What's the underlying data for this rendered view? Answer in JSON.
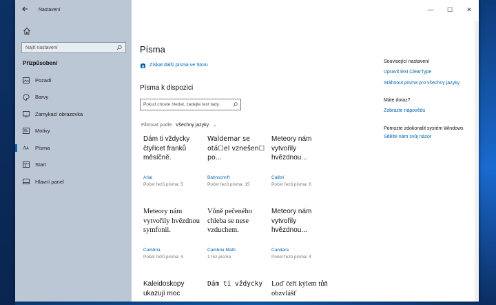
{
  "window": {
    "title": "Nastavení"
  },
  "controls": {
    "minimize": "—",
    "maximize": "☐",
    "close": "✕"
  },
  "sidebar": {
    "search_placeholder": "Najít nastavení",
    "section": "Přizpůsobení",
    "items": [
      {
        "label": "Pozadí",
        "icon": "picture-icon",
        "active": false
      },
      {
        "label": "Barvy",
        "icon": "palette-icon",
        "active": false
      },
      {
        "label": "Zamykací obrazovka",
        "icon": "lockscreen-icon",
        "active": false
      },
      {
        "label": "Motivy",
        "icon": "themes-icon",
        "active": false
      },
      {
        "label": "Písma",
        "icon": "font-icon",
        "active": true
      },
      {
        "label": "Start",
        "icon": "start-icon",
        "active": false
      },
      {
        "label": "Hlavní panel",
        "icon": "taskbar-icon",
        "active": false
      }
    ]
  },
  "main": {
    "title": "Písma",
    "store_link": "Získat další písma ve Storu",
    "available_title": "Písma k dispozici",
    "font_search_placeholder": "Pokud chcete hledat, zadejte text tady.",
    "filter_label": "Filtrovat podle:",
    "filter_value": "Všechny jazyky"
  },
  "fonts": [
    {
      "sample": "Dám ti vždycky čtyřicet franků měsíčně.",
      "name": "Arial",
      "count": "Počet řezů písma: 5",
      "style": "sans"
    },
    {
      "sample": "Waldemar se otá☐el vznešen☐ po...",
      "name": "Bahnschrift",
      "count": "Počet řezů písma: 15",
      "style": "bahn"
    },
    {
      "sample": "Meteory nám vytvořily hvězdnou...",
      "name": "Calibri",
      "count": "Počet řezů písma: 6",
      "style": "sans"
    },
    {
      "sample": "Meteory nám vytvořily hvězdnou symfonii.",
      "name": "Cambria",
      "count": "Počet řezů písma: 4",
      "style": "serif"
    },
    {
      "sample": "Vůně pečeného chleba se nese vzduchem.",
      "name": "Cambria Math",
      "count": "1 řez písma",
      "style": "serif"
    },
    {
      "sample": "Meteory nám vytvořily hvězdnou...",
      "name": "Candara",
      "count": "Počet řezů písma: 4",
      "style": "sans"
    },
    {
      "sample": "Kaleidoskopy ukazují moc",
      "name": "",
      "count": "",
      "style": "sans"
    },
    {
      "sample": "Dám ti vždycky",
      "name": "",
      "count": "",
      "style": "mono"
    },
    {
      "sample": "Loď čeří kýlem tůň obzvlášť",
      "name": "",
      "count": "",
      "style": "serif"
    }
  ],
  "related": {
    "heading": "Související nastavení",
    "links": [
      "Upravit text ClearType",
      "Stáhnout písma pro všechny jazyky"
    ],
    "question": "Máte dotaz?",
    "help_link": "Zobrazte nápovědu",
    "improve_text": "Pomozte zdokonalit systém Windows",
    "feedback_link": "Sdělte nám svůj názor"
  },
  "colors": {
    "accent": "#0063b1",
    "sidebar_bg": "#bcc7d6"
  }
}
